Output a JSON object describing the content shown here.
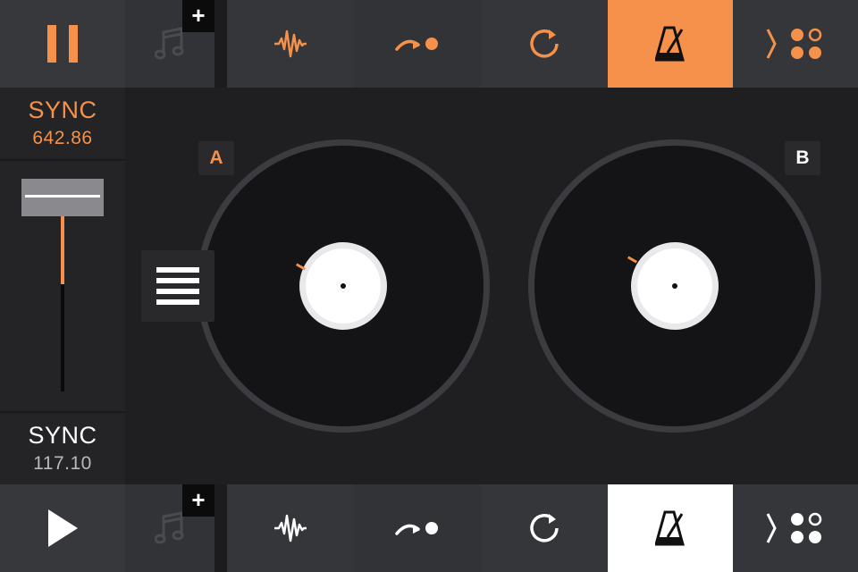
{
  "top_bar": {
    "transport": "pause",
    "library_add": "+",
    "accent_color": "#f5914a",
    "active_tool": "metronome"
  },
  "bottom_bar": {
    "transport": "play",
    "library_add": "+",
    "accent_color": "#ffffff",
    "active_tool": "metronome"
  },
  "deck_a": {
    "tag": "A",
    "sync_label": "SYNC",
    "bpm": "642.86",
    "color": "#f5914a"
  },
  "deck_b": {
    "tag": "B",
    "sync_label": "SYNC",
    "bpm": "117.10",
    "color": "#ffffff"
  },
  "crossfader": {
    "level": 0.4
  },
  "icons": [
    "pause-icon",
    "play-icon",
    "music-note-icon",
    "waveform-icon",
    "cue-icon",
    "loop-icon",
    "metronome-icon",
    "pads-icon",
    "menu-icon"
  ]
}
